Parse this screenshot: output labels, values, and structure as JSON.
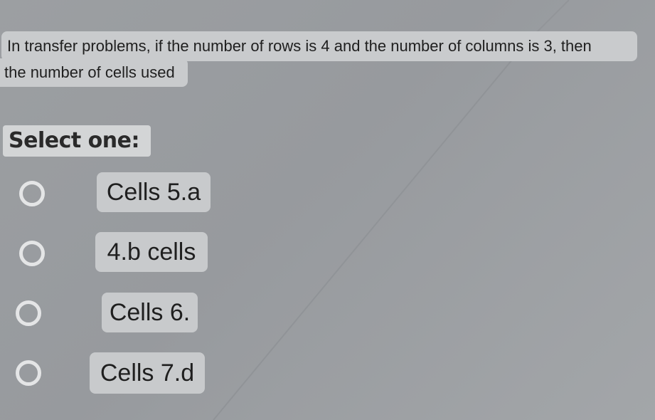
{
  "question": {
    "line1": "In transfer problems, if the number of rows is 4 and the number of columns is 3, then",
    "line2": "the number of cells used"
  },
  "prompt": "Select one:",
  "options": [
    {
      "label": "Cells 5.a"
    },
    {
      "label": "4.b cells"
    },
    {
      "label": "Cells 6."
    },
    {
      "label": "Cells 7.d"
    }
  ],
  "colors": {
    "background": "#9c9fa2",
    "label_bg": "#c9cbcd",
    "radio_ring": "#e4e5e6"
  },
  "icons": {
    "radio": "radio-unchecked-icon"
  }
}
